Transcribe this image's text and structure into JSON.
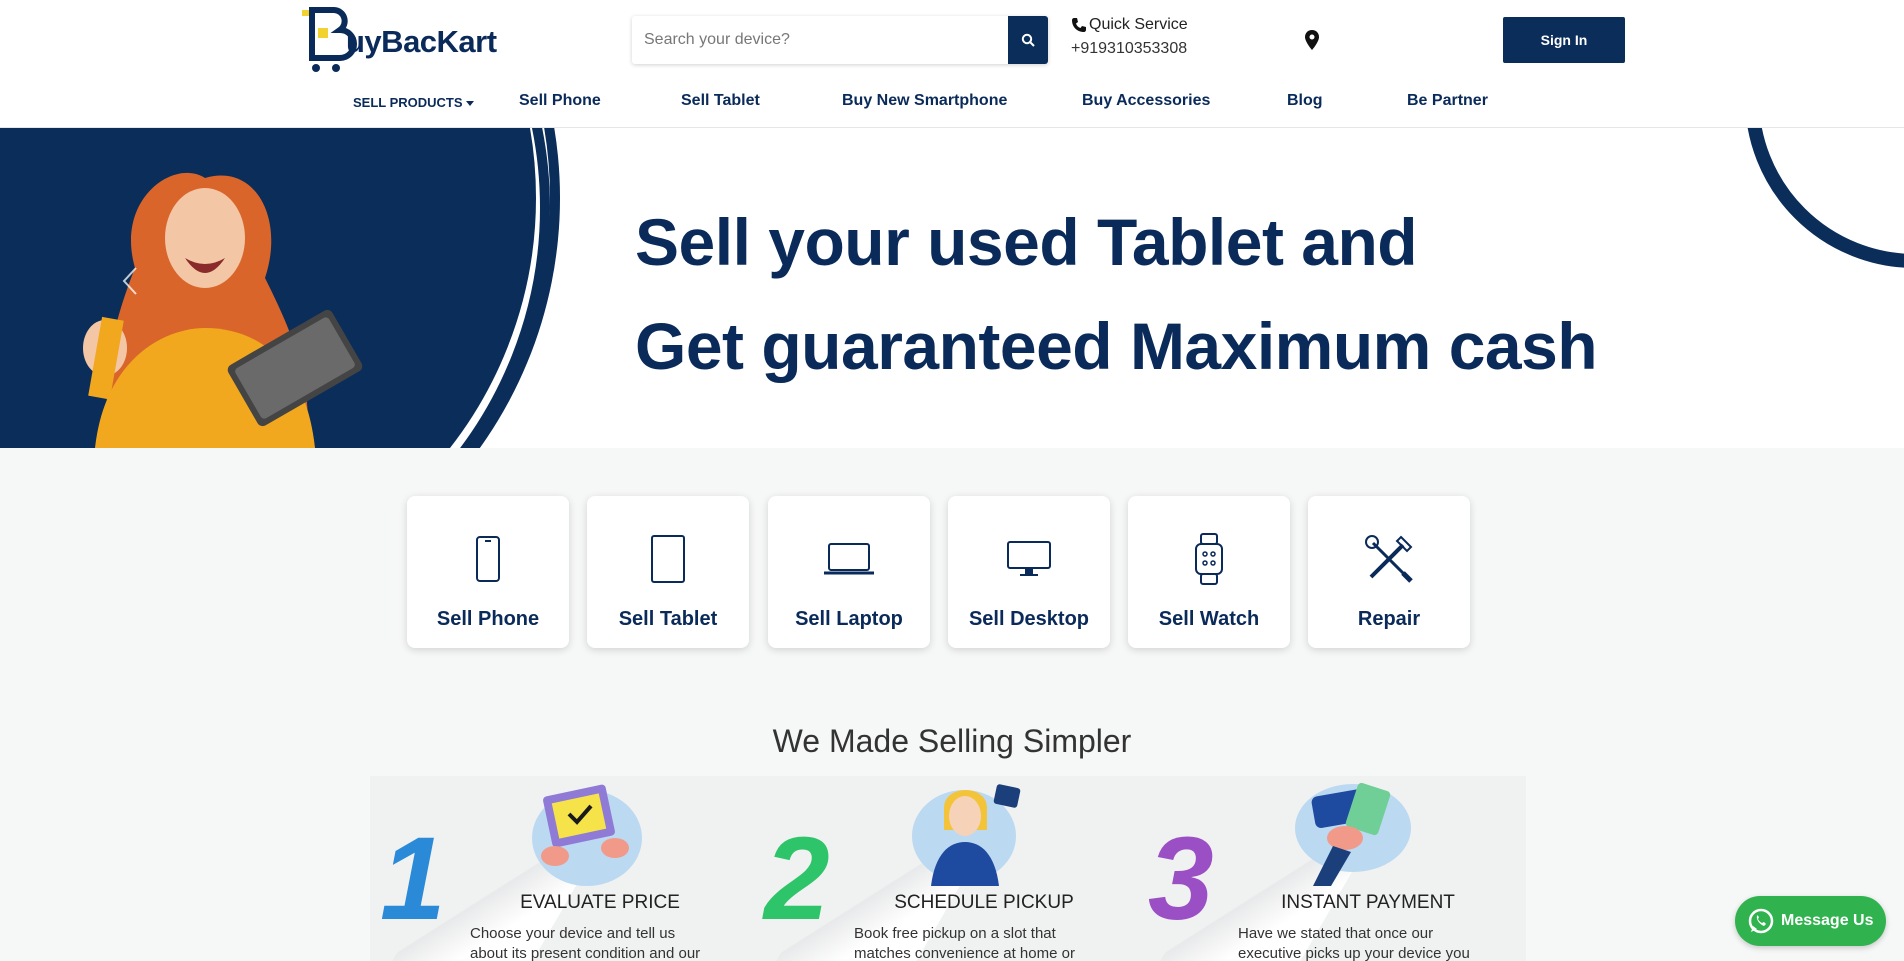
{
  "brand": {
    "name": "BuyBackKart",
    "logo_text": "uyBacKart"
  },
  "search": {
    "placeholder": "Search your device?"
  },
  "contact": {
    "label": "Quick Service",
    "phone": "+919310353308"
  },
  "header": {
    "signin_label": "Sign In"
  },
  "nav": {
    "items": [
      {
        "label": "SELL PRODUCTS"
      },
      {
        "label": "Sell Phone"
      },
      {
        "label": "Sell Tablet"
      },
      {
        "label": "Buy New Smartphone"
      },
      {
        "label": "Buy Accessories"
      },
      {
        "label": "Blog"
      },
      {
        "label": "Be Partner"
      }
    ]
  },
  "banner": {
    "line1": "Sell your used Tablet and",
    "line2": "Get guaranteed Maximum cash"
  },
  "categories": [
    {
      "label": "Sell Phone",
      "icon": "phone-icon"
    },
    {
      "label": "Sell Tablet",
      "icon": "tablet-icon"
    },
    {
      "label": "Sell Laptop",
      "icon": "laptop-icon"
    },
    {
      "label": "Sell Desktop",
      "icon": "desktop-icon"
    },
    {
      "label": "Sell Watch",
      "icon": "watch-icon"
    },
    {
      "label": "Repair",
      "icon": "tools-icon"
    }
  ],
  "steps_section": {
    "title": "We Made Selling Simpler",
    "steps": [
      {
        "number": "1",
        "title": "EVALUATE PRICE",
        "desc": "Choose your device and tell us about its present condition and our",
        "color": "#2b8ad8"
      },
      {
        "number": "2",
        "title": "SCHEDULE PICKUP",
        "desc": "Book free pickup on a slot that matches convenience at home or",
        "color": "#2ec46a"
      },
      {
        "number": "3",
        "title": "INSTANT PAYMENT",
        "desc": "Have we stated that once our executive picks up your device you",
        "color": "#9b4fc4"
      }
    ]
  },
  "whatsapp": {
    "label": "Message Us"
  },
  "colors": {
    "primary": "#0a2d5a",
    "whatsapp": "#30b34e",
    "background": "#f6f7f7"
  }
}
